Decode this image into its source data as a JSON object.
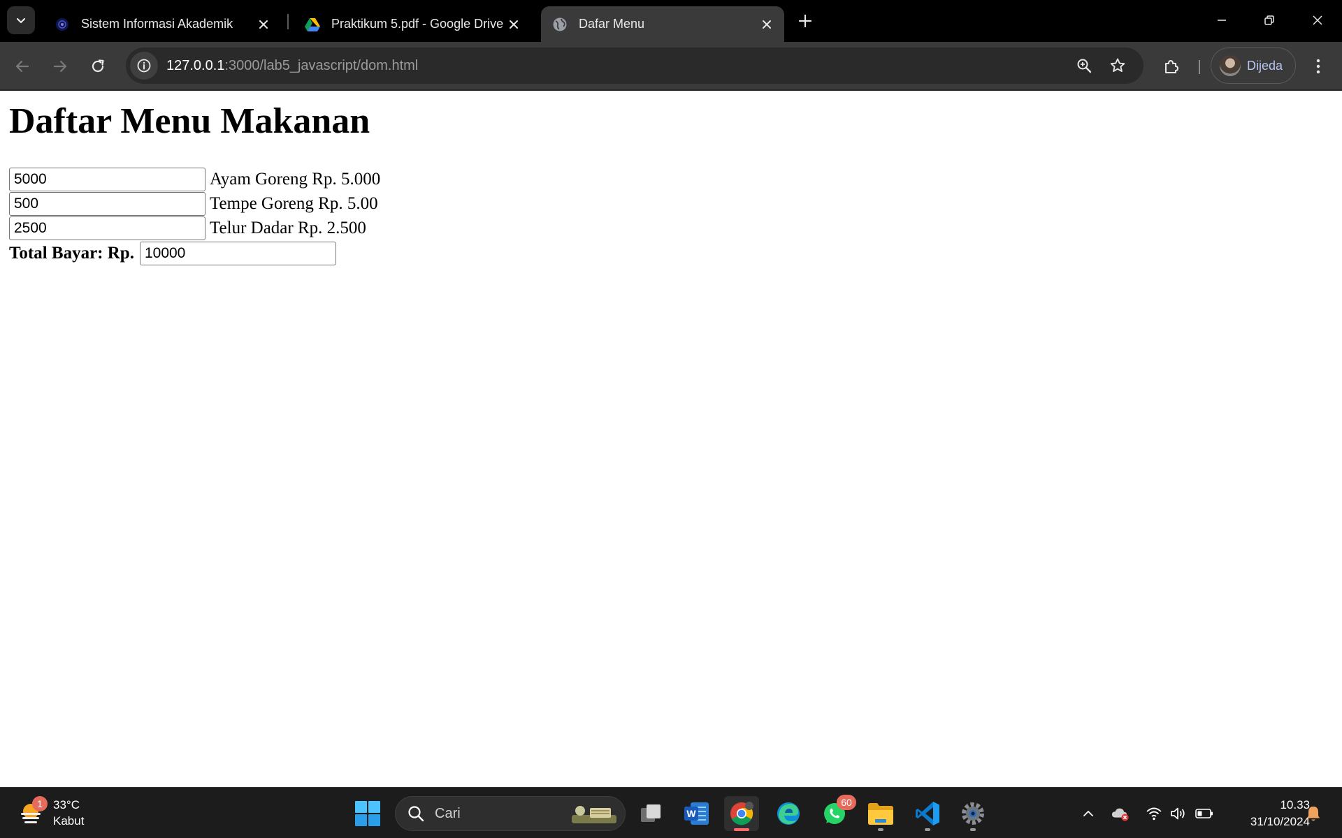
{
  "browser": {
    "tabs": [
      {
        "title": "Sistem Informasi Akademik",
        "icon": "academic-logo-icon",
        "active": false
      },
      {
        "title": "Praktikum 5.pdf - Google Drive",
        "icon": "google-drive-icon",
        "active": false
      },
      {
        "title": "Dafar Menu",
        "icon": "globe-icon",
        "active": true
      }
    ],
    "url_host": "127.0.0.1",
    "url_path": ":3000/lab5_javascript/dom.html",
    "profile_label": "Dijeda"
  },
  "page": {
    "heading": "Daftar Menu Makanan",
    "items": [
      {
        "value": "5000",
        "label": "Ayam Goreng Rp. 5.000"
      },
      {
        "value": "500",
        "label": "Tempe Goreng Rp. 5.00"
      },
      {
        "value": "2500",
        "label": "Telur Dadar Rp. 2.500"
      }
    ],
    "total_label": "Total Bayar: Rp.",
    "total_value": "10000"
  },
  "taskbar": {
    "weather_temp": "33°C",
    "weather_desc": "Kabut",
    "weather_badge": "1",
    "search_placeholder": "Cari",
    "whatsapp_badge": "60",
    "time": "10.33",
    "date": "31/10/2024"
  },
  "colors": {
    "tabstrip": "#000000",
    "toolbar": "#3a3a3a",
    "taskbar": "#1c1c1c",
    "badge": "#e56b5c"
  }
}
